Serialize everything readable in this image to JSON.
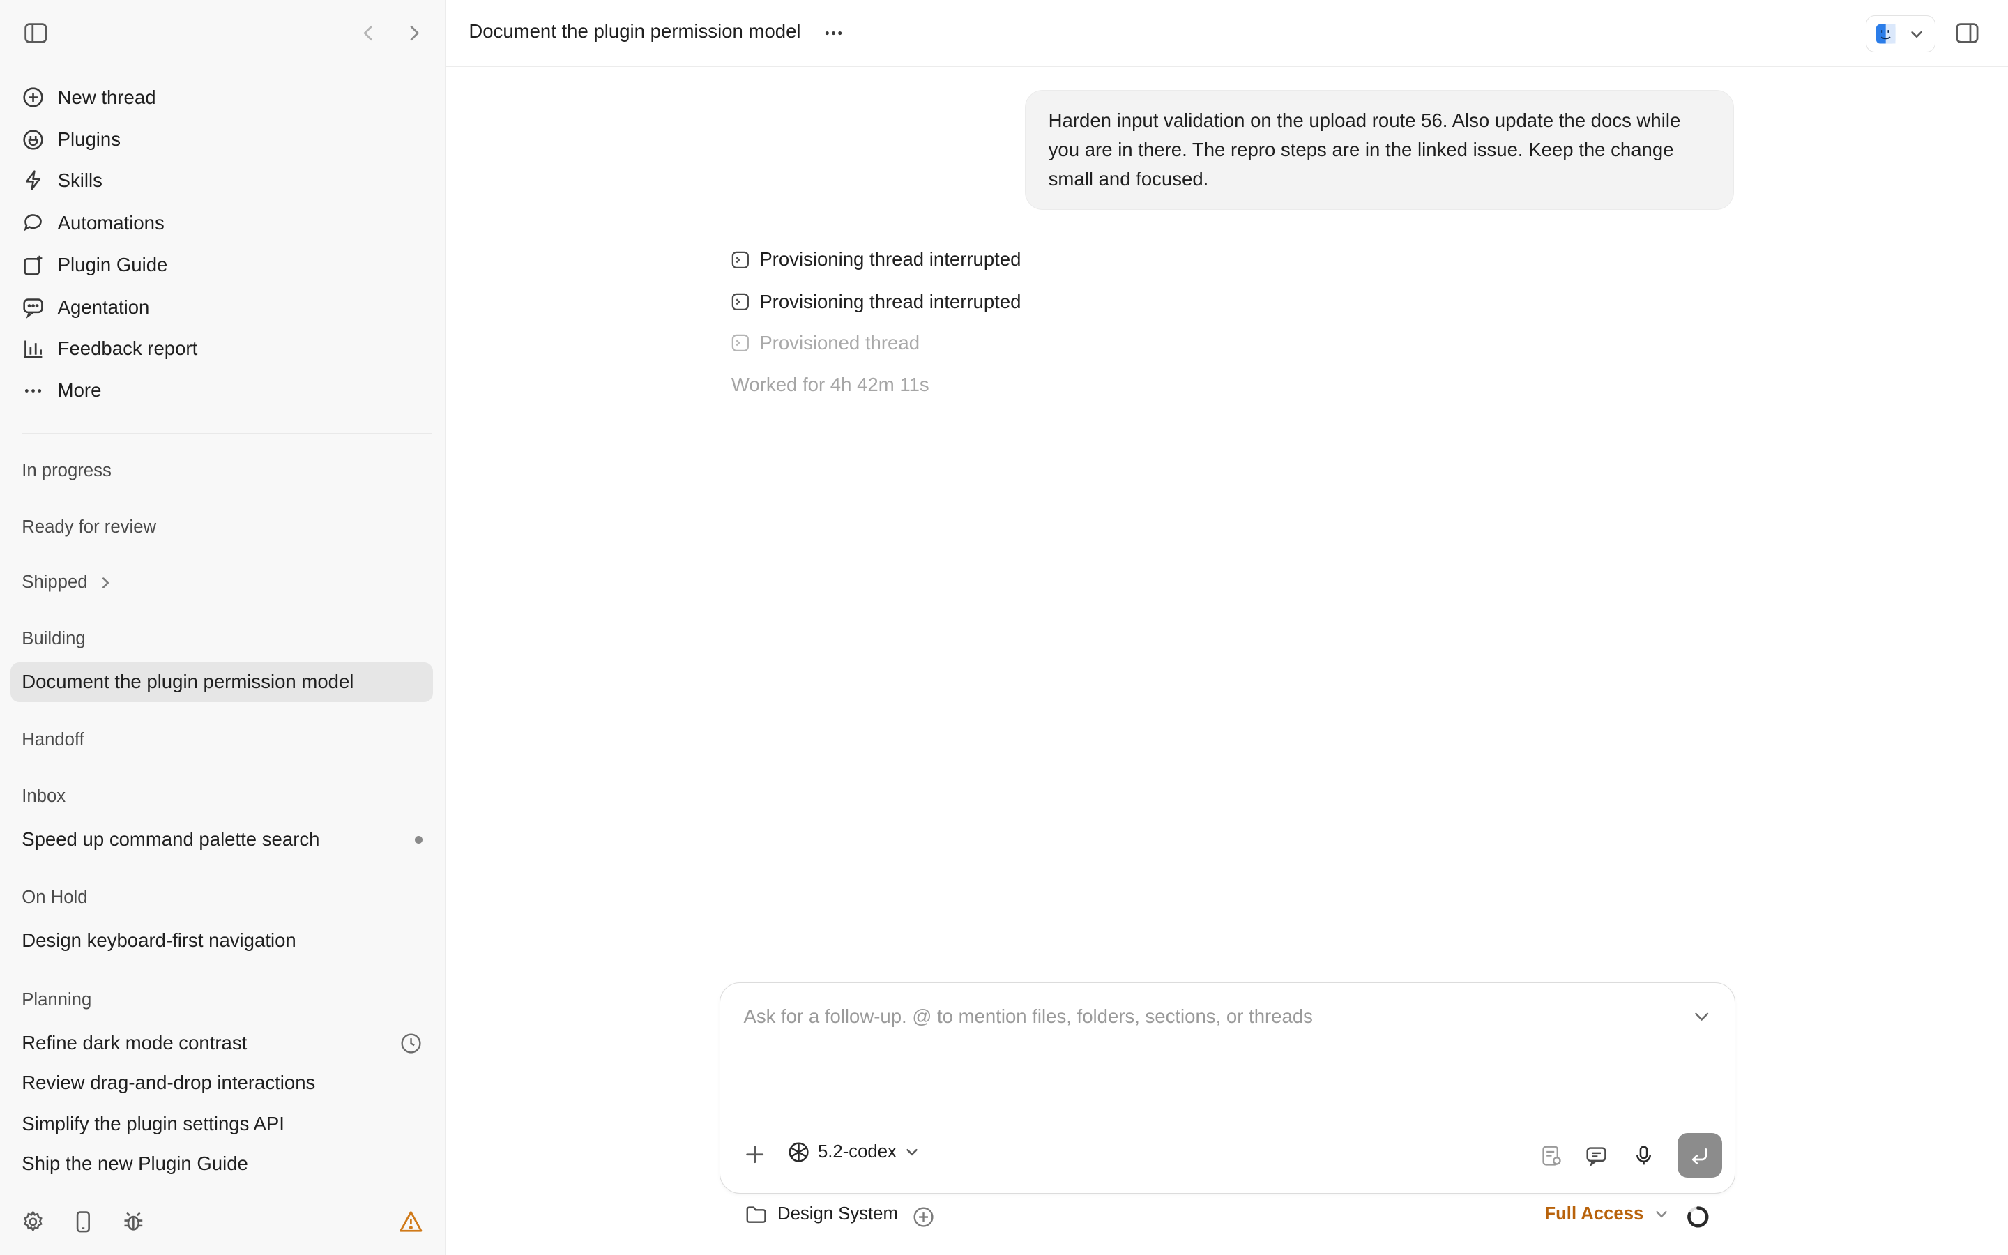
{
  "header": {
    "title": "Document the plugin permission model"
  },
  "sidebar": {
    "nav": [
      {
        "label": "New thread",
        "icon": "plus-circle-icon"
      },
      {
        "label": "Plugins",
        "icon": "plugin-icon"
      },
      {
        "label": "Skills",
        "icon": "bolt-icon"
      },
      {
        "label": "Automations",
        "icon": "chat-loop-icon"
      },
      {
        "label": "Plugin Guide",
        "icon": "sparkle-doc-icon"
      },
      {
        "label": "Agentation",
        "icon": "chat-dots-icon"
      },
      {
        "label": "Feedback report",
        "icon": "bar-chart-icon"
      },
      {
        "label": "More",
        "icon": "ellipsis-icon"
      }
    ],
    "sections": {
      "in_progress": "In progress",
      "ready_for_review": "Ready for review",
      "shipped": "Shipped",
      "building": "Building",
      "handoff": "Handoff",
      "inbox": "Inbox",
      "on_hold": "On Hold",
      "planning": "Planning"
    },
    "threads": {
      "building": [
        "Document the plugin permission model"
      ],
      "inbox": [
        "Speed up command palette search"
      ],
      "on_hold": [
        "Design keyboard-first navigation"
      ],
      "planning": [
        "Refine dark mode contrast",
        "Review drag-and-drop interactions",
        "Simplify the plugin settings API",
        "Ship the new Plugin Guide"
      ]
    }
  },
  "conversation": {
    "user_message": "Harden input validation on the upload route 56. Also update the docs while you are in there. The repro steps are in the linked issue. Keep the change small and focused.",
    "steps": [
      {
        "label": "Provisioning thread interrupted"
      },
      {
        "label": "Provisioning thread interrupted"
      },
      {
        "label": "Provisioned thread"
      }
    ],
    "worked_for": "Worked for 4h 42m 11s"
  },
  "composer": {
    "placeholder": "Ask for a follow-up. @ to mention files, folders, sections, or threads",
    "model": "5.2-codex",
    "project": "Design System",
    "access": "Full Access"
  },
  "colors": {
    "accent_warning": "#b8620b",
    "send_button": "#8c8c8c",
    "active_thread_bg": "#e6e6e6"
  }
}
